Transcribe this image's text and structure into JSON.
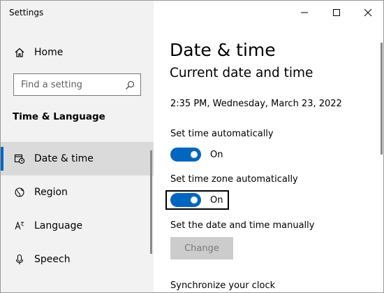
{
  "window": {
    "title": "Settings",
    "controls": [
      "minimize",
      "maximize",
      "close"
    ]
  },
  "sidebar": {
    "home_label": "Home",
    "search_placeholder": "Find a setting",
    "section_heading": "Time & Language",
    "items": [
      {
        "label": "Date & time",
        "icon": "calendar-clock-icon",
        "selected": true
      },
      {
        "label": "Region",
        "icon": "globe-icon",
        "selected": false
      },
      {
        "label": "Language",
        "icon": "language-icon",
        "selected": false
      },
      {
        "label": "Speech",
        "icon": "microphone-icon",
        "selected": false
      }
    ]
  },
  "main": {
    "title": "Date & time",
    "subtitle": "Current date and time",
    "current_datetime": "2:35 PM, Wednesday, March 23, 2022",
    "set_time_auto": {
      "label": "Set time automatically",
      "state": "On"
    },
    "set_timezone_auto": {
      "label": "Set time zone automatically",
      "state": "On"
    },
    "manual_label": "Set the date and time manually",
    "change_button": "Change",
    "sync_label": "Synchronize your clock"
  },
  "colors": {
    "accent": "#0067c0",
    "sidebar_bg": "#f2f2f2",
    "selected_bg": "#dadada",
    "disabled_button": "#cccccc"
  }
}
